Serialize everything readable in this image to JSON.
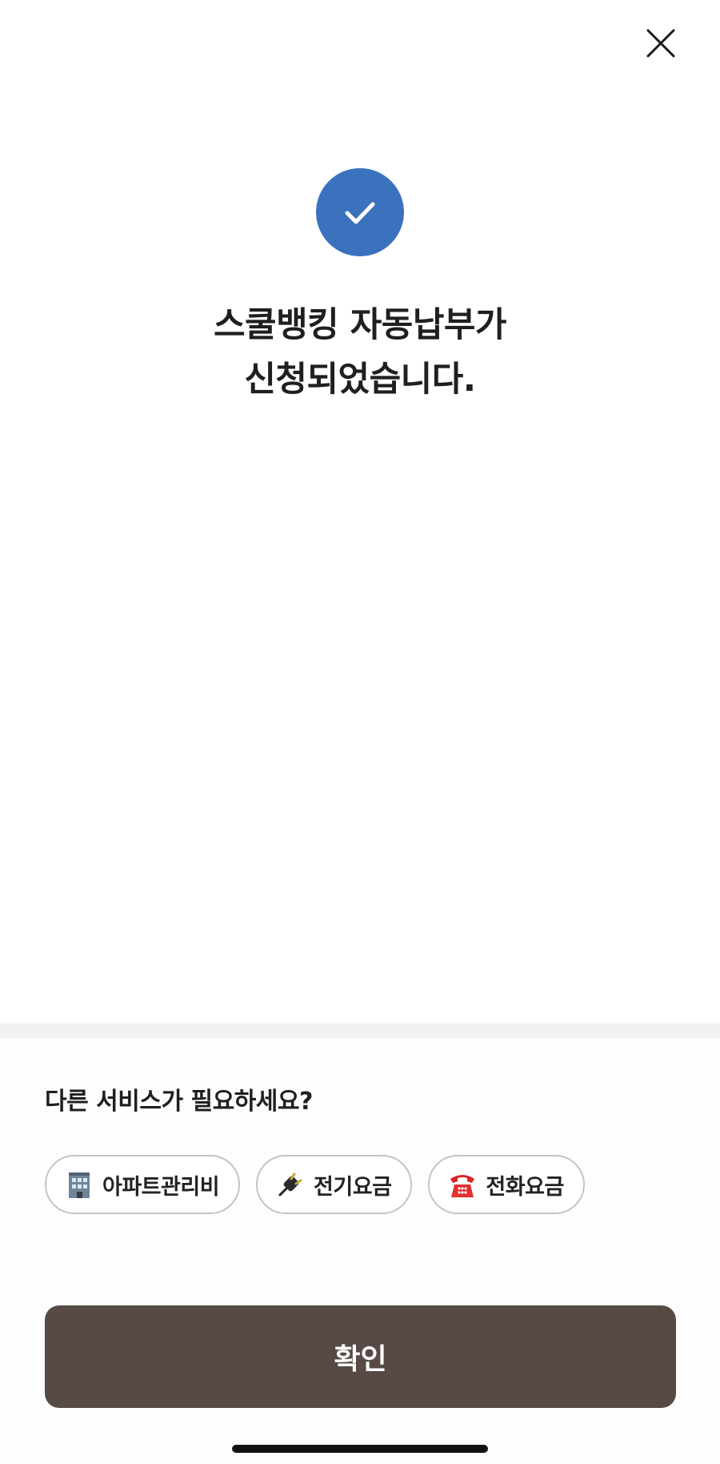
{
  "header": {
    "close_icon": "close-icon"
  },
  "success": {
    "icon": "check-icon",
    "accent_color": "#3a72bd",
    "title_line1": "스쿨뱅킹 자동납부가",
    "title_line2": "신청되었습니다."
  },
  "other_services": {
    "question": "다른 서비스가 필요하세요?",
    "chips": [
      {
        "icon": "building-icon",
        "label": "아파트관리비"
      },
      {
        "icon": "plug-icon",
        "label": "전기요금"
      },
      {
        "icon": "telephone-icon",
        "label": "전화요금"
      }
    ]
  },
  "footer": {
    "confirm_label": "확인",
    "button_color": "#574a45"
  }
}
